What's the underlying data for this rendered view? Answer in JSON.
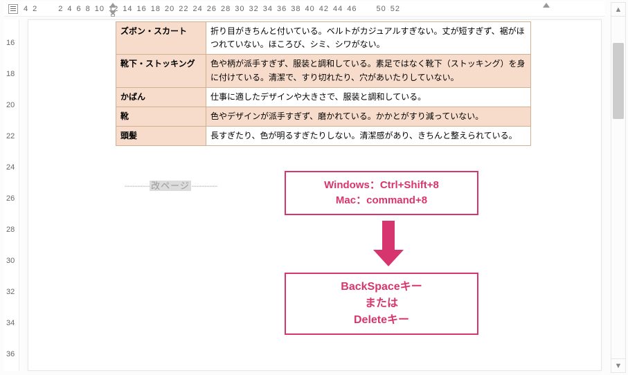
{
  "colors": {
    "accent": "#d7356d",
    "table_shade": "#f7dccb"
  },
  "hruler": {
    "numbers": [
      "4",
      "2",
      "",
      "2",
      "4",
      "6",
      "8",
      "10",
      "12",
      "14",
      "16",
      "18",
      "20",
      "22",
      "24",
      "26",
      "28",
      "30",
      "32",
      "34",
      "36",
      "38",
      "40",
      "42",
      "44",
      "46",
      "",
      "50",
      "52"
    ]
  },
  "vruler": {
    "numbers": [
      "16",
      "18",
      "20",
      "22",
      "24",
      "26",
      "28",
      "30",
      "32",
      "34",
      "36"
    ]
  },
  "table": {
    "rows": [
      {
        "header": "ズボン・スカート",
        "content": "折り目がきちんと付いている。ベルトがカジュアルすぎない。丈が短すぎず、裾がほつれていない。ほころび、シミ、シワがない。"
      },
      {
        "header": "靴下・ストッキング",
        "content": "色や柄が派手すぎず、服装と調和している。素足ではなく靴下（ストッキング）を身に付けている。清潔で、すり切れたり、穴があいたりしていない。"
      },
      {
        "header": "かばん",
        "content": "仕事に適したデザインや大きさで、服装と調和している。"
      },
      {
        "header": "靴",
        "content": "色やデザインが派手すぎず、磨かれている。かかとがすり減っていない。"
      },
      {
        "header": "頭髪",
        "content": "長すぎたり、色が明るすぎたりしない。清潔感があり、きちんと整えられている。"
      }
    ]
  },
  "pagebreak_label": "改ページ",
  "callout1": {
    "line1": "Windows：Ctrl+Shift+8",
    "line2": "Mac：command+8"
  },
  "callout2": {
    "line1": "BackSpaceキー",
    "line2": "または",
    "line3": "Deleteキー"
  }
}
